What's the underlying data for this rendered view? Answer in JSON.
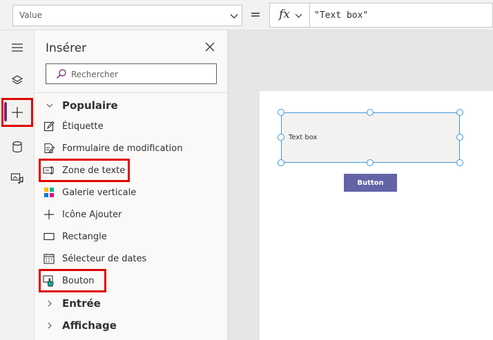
{
  "formula_bar": {
    "property_value": "Value",
    "equals": "=",
    "fx_label": "fx",
    "formula": "\"Text box\""
  },
  "rail": {
    "items": [
      {
        "icon": "hamburger-icon"
      },
      {
        "icon": "layers-icon"
      },
      {
        "icon": "plus-icon",
        "active": true
      },
      {
        "icon": "database-icon"
      },
      {
        "icon": "media-icon"
      }
    ]
  },
  "insert_pane": {
    "title": "Insérer",
    "search_placeholder": "Rechercher",
    "categories": [
      {
        "label": "Populaire",
        "expanded": true,
        "items": [
          {
            "label": "Étiquette",
            "icon": "label-edit-icon"
          },
          {
            "label": "Formulaire de modification",
            "icon": "form-edit-icon"
          },
          {
            "label": "Zone de texte",
            "icon": "text-input-icon"
          },
          {
            "label": "Galerie verticale",
            "icon": "gallery-icon"
          },
          {
            "label": "Icône Ajouter",
            "icon": "add-icon"
          },
          {
            "label": "Rectangle",
            "icon": "rectangle-icon"
          },
          {
            "label": "Sélecteur de dates",
            "icon": "calendar-icon"
          },
          {
            "label": "Bouton",
            "icon": "button-icon"
          }
        ]
      },
      {
        "label": "Entrée",
        "expanded": false
      },
      {
        "label": "Affichage",
        "expanded": false
      }
    ]
  },
  "canvas": {
    "textbox_text": "Text box",
    "button_label": "Button"
  },
  "colors": {
    "accent": "#742774",
    "highlight": "#e00000",
    "selection": "#3a96dd",
    "button": "#6264a7"
  }
}
